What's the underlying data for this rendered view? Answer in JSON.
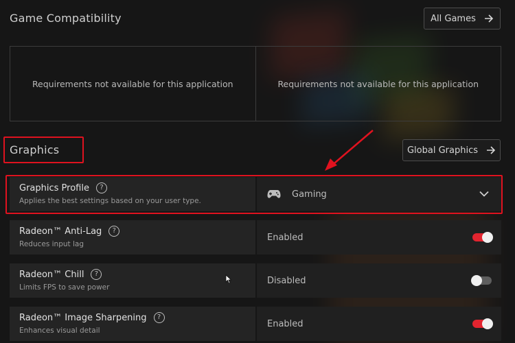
{
  "game_compatibility": {
    "title": "Game Compatibility",
    "all_games_label": "All Games",
    "requirements": [
      "Requirements not available for this application",
      "Requirements not available for this application"
    ]
  },
  "graphics": {
    "title": "Graphics",
    "global_graphics_label": "Global Graphics"
  },
  "settings": [
    {
      "name": "Graphics Profile",
      "description": "Applies the best settings based on your user type.",
      "value": "Gaming",
      "control": "dropdown",
      "icon": "gamepad-icon"
    },
    {
      "name": "Radeon™ Anti-Lag",
      "description": "Reduces input lag",
      "value": "Enabled",
      "control": "toggle",
      "enabled": true
    },
    {
      "name": "Radeon™ Chill",
      "description": "Limits FPS to save power",
      "value": "Disabled",
      "control": "toggle",
      "enabled": false
    },
    {
      "name": "Radeon™ Image Sharpening",
      "description": "Enhances visual detail",
      "value": "Enabled",
      "control": "toggle",
      "enabled": true
    }
  ],
  "colors": {
    "accent_red": "#e2242f",
    "highlight_red": "#e0121f",
    "background": "#161616"
  }
}
